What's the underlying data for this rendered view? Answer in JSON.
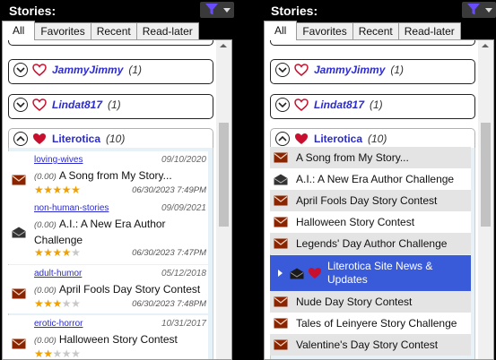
{
  "colors": {
    "background": "#000000",
    "group_name": "#2a2ad0",
    "envelope": "#8b2500",
    "heart": "#c8102e",
    "star": "#f0a000",
    "selection": "#3a5bd9",
    "filter_icon": "#6a4cff"
  },
  "left": {
    "title": "Stories:",
    "tabs": [
      {
        "label": "All",
        "active": true
      },
      {
        "label": "Favorites"
      },
      {
        "label": "Recent"
      },
      {
        "label": "Read-later"
      }
    ],
    "groups": [
      {
        "name": "JammyJimmy",
        "count": "(1)",
        "expanded": false,
        "favorite": false
      },
      {
        "name": "Lindat817",
        "count": "(1)",
        "expanded": false,
        "favorite": false
      },
      {
        "name": "Literotica",
        "count": "(10)",
        "expanded": true,
        "favorite": true
      }
    ],
    "stories": [
      {
        "category": "loving-wives",
        "date_published": "09/10/2020",
        "score": "(0.00)",
        "title": "A Song from My Story...",
        "rating": 5,
        "date_read": "06/30/2023 7:49PM",
        "icon": "envelope-closed-icon"
      },
      {
        "category": "non-human-stories",
        "date_published": "09/09/2021",
        "score": "(0.00)",
        "title": "A.I.: A New Era Author Challenge",
        "rating": 4,
        "date_read": "06/30/2023 7:47PM",
        "icon": "envelope-open-icon"
      },
      {
        "category": "adult-humor",
        "date_published": "05/12/2018",
        "score": "(0.00)",
        "title": "April Fools Day Story Contest",
        "rating": 3,
        "date_read": "06/30/2023 7:48PM",
        "icon": "envelope-closed-icon"
      },
      {
        "category": "erotic-horror",
        "date_published": "10/31/2017",
        "score": "(0.00)",
        "title": "Halloween Story Contest",
        "rating": 2,
        "date_read": "",
        "icon": "envelope-closed-icon"
      }
    ]
  },
  "right": {
    "title": "Stories:",
    "tabs": [
      {
        "label": "All",
        "active": true
      },
      {
        "label": "Favorites"
      },
      {
        "label": "Recent"
      },
      {
        "label": "Read-later"
      }
    ],
    "groups": [
      {
        "name": "JammyJimmy",
        "count": "(1)",
        "expanded": false,
        "favorite": false
      },
      {
        "name": "Lindat817",
        "count": "(1)",
        "expanded": false,
        "favorite": false
      },
      {
        "name": "Literotica",
        "count": "(10)",
        "expanded": true,
        "favorite": true
      }
    ],
    "stories": [
      {
        "title": "A Song from My Story...",
        "icon": "envelope-closed-icon"
      },
      {
        "title": "A.I.: A New Era Author Challenge",
        "icon": "envelope-open-icon"
      },
      {
        "title": "April Fools Day Story Contest",
        "icon": "envelope-closed-icon"
      },
      {
        "title": "Halloween Story Contest",
        "icon": "envelope-closed-icon"
      },
      {
        "title": "Legends' Day Author Challenge",
        "icon": "envelope-closed-icon"
      },
      {
        "title": "Literotica Site News & Updates",
        "icon": "envelope-open-icon",
        "favorite": true,
        "selected": true
      },
      {
        "title": "Nude Day Story Contest",
        "icon": "envelope-closed-icon"
      },
      {
        "title": "Tales of Leinyere Story Challenge",
        "icon": "envelope-closed-icon"
      },
      {
        "title": "Valentine's Day Story Contest",
        "icon": "envelope-closed-icon"
      }
    ]
  }
}
